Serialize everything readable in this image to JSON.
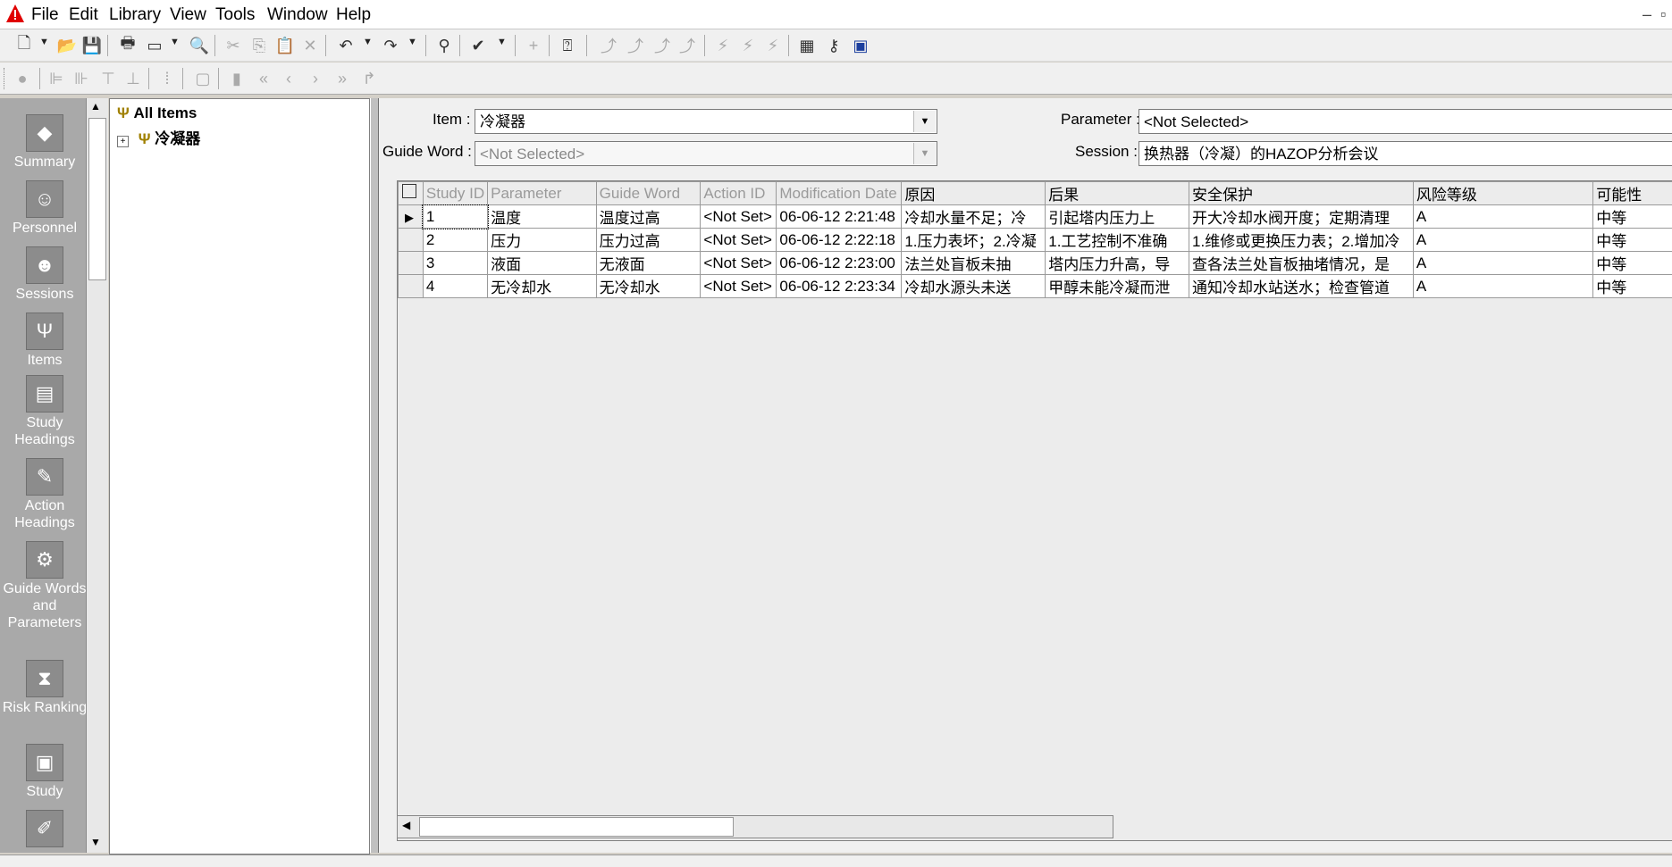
{
  "menu": [
    "File",
    "Edit",
    "Library",
    "View",
    "Tools",
    "Window",
    "Help"
  ],
  "sidebar": [
    {
      "label": "Summary",
      "icon": "summary-icon",
      "glyph": "◆"
    },
    {
      "label": "Personnel",
      "icon": "personnel-icon",
      "glyph": "☺"
    },
    {
      "label": "Sessions",
      "icon": "sessions-icon",
      "glyph": "☻"
    },
    {
      "label": "Items",
      "icon": "items-icon",
      "glyph": "Ψ"
    },
    {
      "label": "Study Headings",
      "icon": "study-headings-icon",
      "glyph": "▤"
    },
    {
      "label": "Action Headings",
      "icon": "action-headings-icon",
      "glyph": "✎"
    },
    {
      "label": "Guide Words and Parameters",
      "icon": "guide-words-icon",
      "glyph": "⚙"
    },
    {
      "label": "Risk Ranking",
      "icon": "risk-ranking-icon",
      "glyph": "⧗"
    },
    {
      "label": "Study",
      "icon": "study-icon",
      "glyph": "▣"
    },
    {
      "label": "",
      "icon": "action-icon",
      "glyph": "✐"
    }
  ],
  "tree": {
    "root": "All Items",
    "child": "冷凝器"
  },
  "filters": {
    "item_label": "Item :",
    "item_value": "冷凝器",
    "guide_label": "Guide Word :",
    "guide_value": "<Not Selected>",
    "param_label": "Parameter :",
    "param_value": "<Not Selected>",
    "session_label": "Session :",
    "session_value": "换热器（冷凝）的HAZOP分析会议"
  },
  "table": {
    "headers": [
      "Study ID",
      "Parameter",
      "Guide Word",
      "Action ID",
      "Modification Date",
      "原因",
      "后果",
      "安全保护",
      "风险等级",
      "可能性"
    ],
    "rows": [
      [
        "1",
        "温度",
        "温度过高",
        "<Not Set>",
        "06-06-12 2:21:48",
        "冷却水量不足；冷",
        "引起塔内压力上",
        "开大冷却水阀开度；定期清理",
        "A",
        "中等"
      ],
      [
        "2",
        "压力",
        "压力过高",
        "<Not Set>",
        "06-06-12 2:22:18",
        "1.压力表坏；2.冷凝",
        "1.工艺控制不准确",
        "1.维修或更换压力表；2.增加冷",
        "A",
        "中等"
      ],
      [
        "3",
        "液面",
        "无液面",
        "<Not Set>",
        "06-06-12 2:23:00",
        "法兰处盲板未抽",
        "塔内压力升高，导",
        "查各法兰处盲板抽堵情况，是",
        "A",
        "中等"
      ],
      [
        "4",
        "无冷却水",
        "无冷却水",
        "<Not Set>",
        "06-06-12 2:23:34",
        "冷却水源头未送",
        "甲醇未能冷凝而泄",
        "通知冷却水站送水；检查管道",
        "A",
        "中等"
      ]
    ]
  },
  "colors": {
    "risk_header": "#ff0000",
    "sidebar": "#a9a9a9"
  }
}
